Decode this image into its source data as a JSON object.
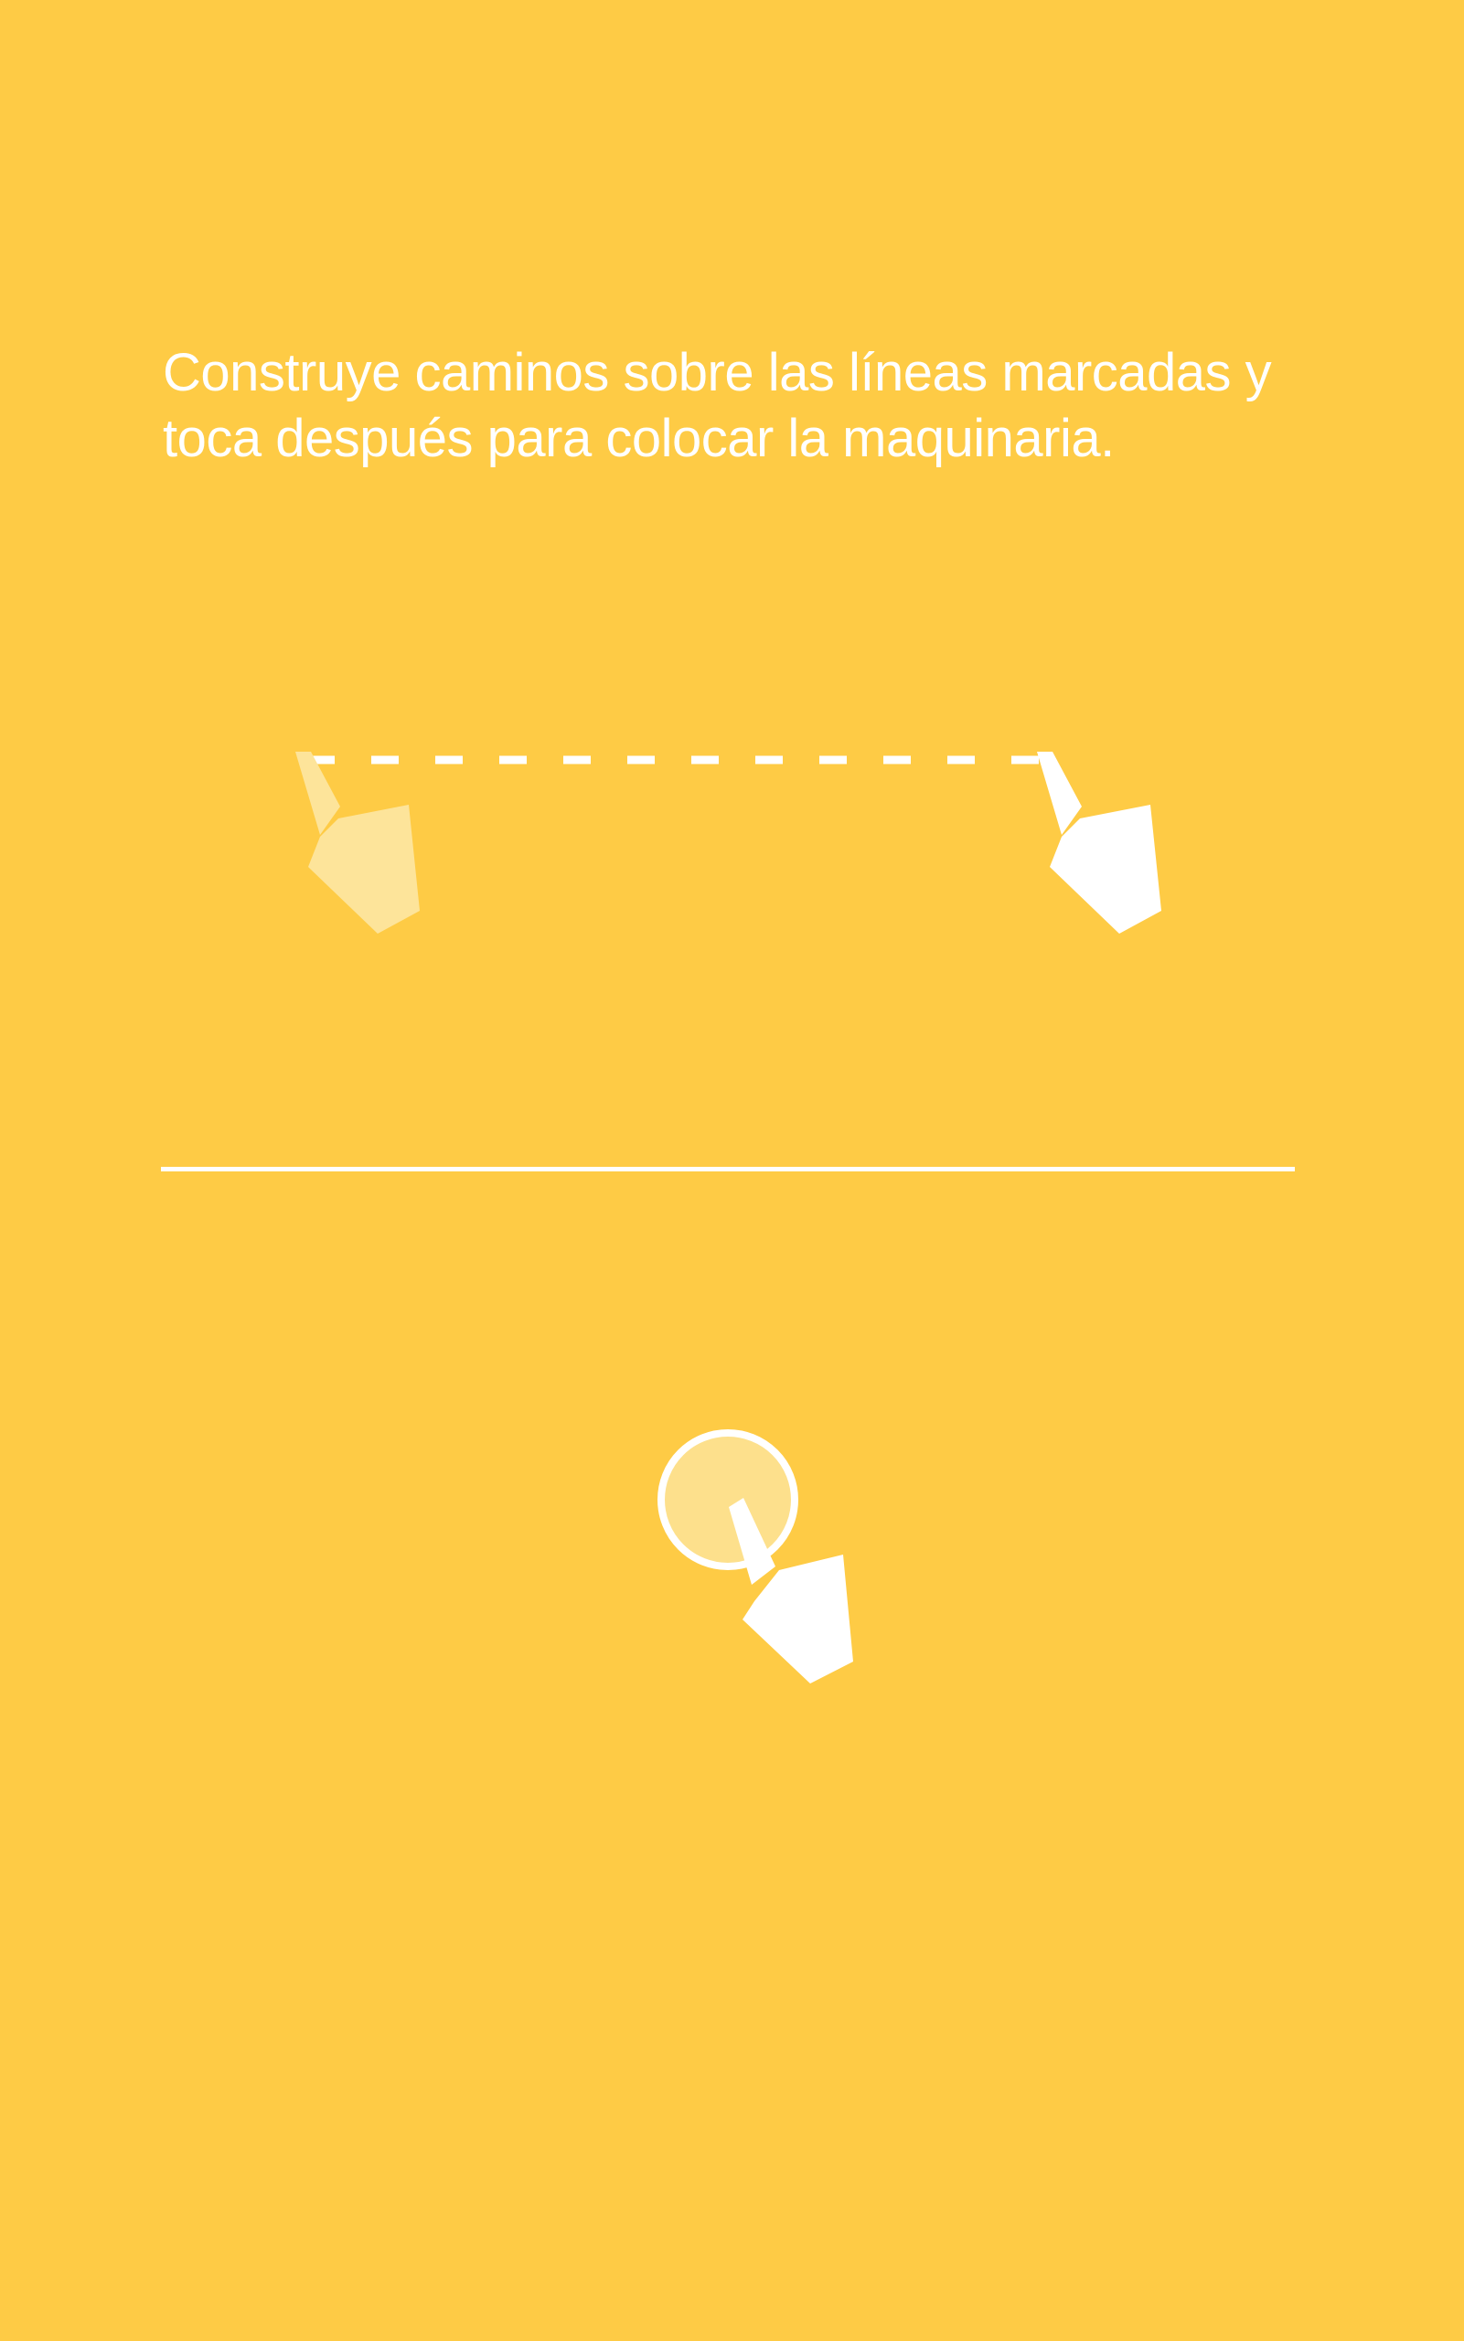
{
  "instructions": {
    "line1": "Construye caminos sobre las líneas marcadas y",
    "line2": "toca después para colocar la maquinaria."
  },
  "icons": {
    "swipe_start_hand": "hand-pointer-icon",
    "swipe_end_hand": "hand-pointer-icon",
    "tap_hand": "hand-pointer-icon",
    "tap_indicator": "tap-circle-icon",
    "swipe_path": "dashed-line-icon"
  },
  "colors": {
    "background": "#FECB45",
    "foreground": "#FFFFFF",
    "faded_hand": "#FDE49A",
    "tap_fill": "#FDE08C"
  }
}
